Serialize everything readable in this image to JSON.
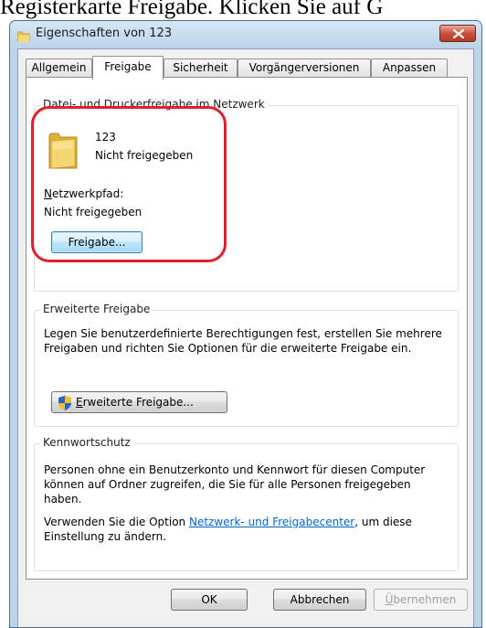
{
  "page_caption": "Registerkarte Freigabe. Klicken Sie auf G",
  "window": {
    "title": "Eigenschaften von 123",
    "title_icon": "folder-icon",
    "close_icon": "close-icon"
  },
  "tabs": [
    {
      "label": "Allgemein",
      "active": false
    },
    {
      "label": "Freigabe",
      "active": true
    },
    {
      "label": "Sicherheit",
      "active": false
    },
    {
      "label": "Vorgängerversionen",
      "active": false
    },
    {
      "label": "Anpassen",
      "active": false
    }
  ],
  "network_sharing": {
    "title": "Datei- und Druckerfreigabe im Netzwerk",
    "folder_name": "123",
    "folder_status": "Nicht freigegeben",
    "network_path_label_accel": "N",
    "network_path_label_rest": "etzwerkpfad:",
    "network_path_value": "Nicht freigegeben",
    "share_button": "Freigabe...",
    "folder_icon": "folder-icon"
  },
  "advanced_sharing": {
    "title": "Erweiterte Freigabe",
    "description": "Legen Sie benutzerdefinierte Berechtigungen fest, erstellen Sie mehrere Freigaben und richten Sie Optionen für die erweiterte Freigabe ein.",
    "button_accel": "E",
    "button_rest": "rweiterte Freigabe...",
    "button_icon": "shield-icon"
  },
  "password_protection": {
    "title": "Kennwortschutz",
    "description": "Personen ohne ein Benutzerkonto und Kennwort für diesen Computer können auf Ordner zugreifen, die Sie für alle Personen freigegeben haben.",
    "hint_prefix": "Verwenden Sie die Option ",
    "hint_link": "Netzwerk- und Freigabecenter",
    "hint_suffix": ", um diese Einstellung zu ändern."
  },
  "footer": {
    "ok": "OK",
    "cancel": "Abbrechen",
    "apply_accel": "Ü",
    "apply_rest": "bernehmen"
  },
  "colors": {
    "highlight": "#e0202c",
    "link": "#0066cc",
    "titlebar": "#bcd3ea"
  }
}
